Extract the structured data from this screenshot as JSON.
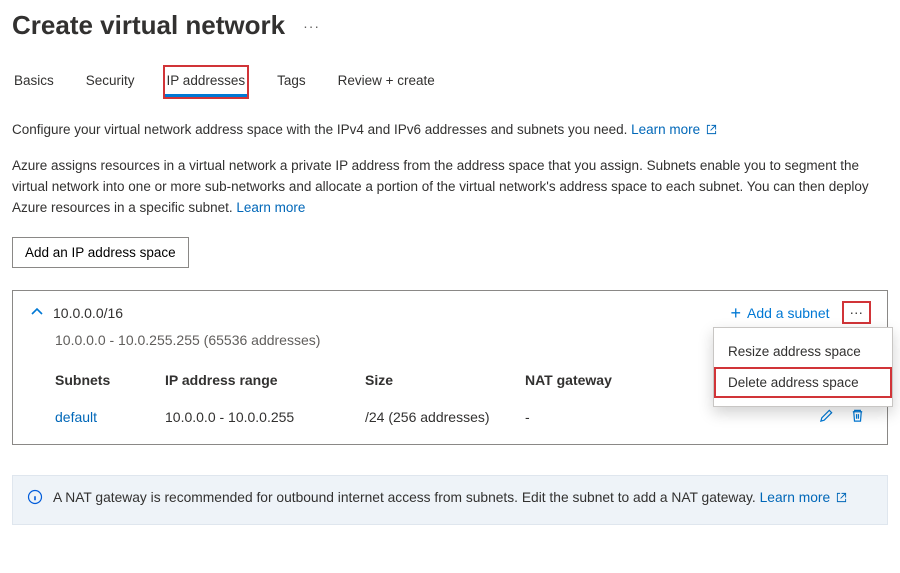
{
  "header": {
    "title": "Create virtual network",
    "ellipsis": "···"
  },
  "tabs": {
    "basics": "Basics",
    "security": "Security",
    "ip": "IP addresses",
    "tags": "Tags",
    "review": "Review + create"
  },
  "desc": {
    "line1a": "Configure your virtual network address space with the IPv4 and IPv6 addresses and subnets you need. ",
    "learn1": "Learn more",
    "line2a": "Azure assigns resources in a virtual network a private IP address from the address space that you assign. Subnets enable you to segment the virtual network into one or more sub-networks and allocate a portion of the virtual network's address space to each subnet. You can then deploy Azure resources in a specific subnet. ",
    "learn2": "Learn more"
  },
  "buttons": {
    "add_space": "Add an IP address space",
    "add_subnet": "Add a subnet",
    "more": "···"
  },
  "space": {
    "cidr": "10.0.0.0/16",
    "range": "10.0.0.0 - 10.0.255.255 (65536 addresses)"
  },
  "table": {
    "headers": {
      "subnets": "Subnets",
      "range": "IP address range",
      "size": "Size",
      "nat": "NAT gateway"
    },
    "row": {
      "name": "default",
      "range": "10.0.0.0 - 10.0.0.255",
      "size": "/24 (256 addresses)",
      "nat": "-"
    }
  },
  "menu": {
    "resize": "Resize address space",
    "delete": "Delete address space"
  },
  "info": {
    "text": "A NAT gateway is recommended for outbound internet access from subnets. Edit the subnet to add a NAT gateway. ",
    "link": "Learn more"
  }
}
